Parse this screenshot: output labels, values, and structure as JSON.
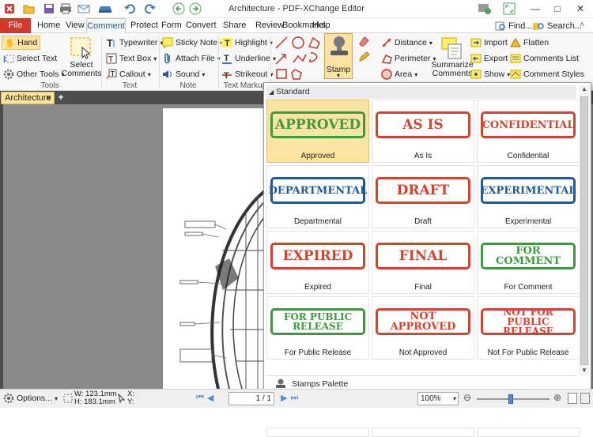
{
  "window": {
    "title": "Architecture - PDF-XChange Editor"
  },
  "quick_access": {
    "find_label": "Find...",
    "search_label": "Search..."
  },
  "menu": [
    "File",
    "Home",
    "View",
    "Comment",
    "Protect",
    "Form",
    "Convert",
    "Share",
    "Review",
    "Bookmarks",
    "Help"
  ],
  "ribbon": {
    "tools": {
      "hand": "Hand",
      "select_text": "Select Text",
      "other_tools": "Other Tools",
      "select_comments": "Select Comments",
      "group": "Tools"
    },
    "text": {
      "typewriter": "Typewriter",
      "text_box": "Text Box",
      "callout": "Callout",
      "group": "Text"
    },
    "note": {
      "sticky_note": "Sticky Note",
      "attach_file": "Attach File",
      "sound": "Sound",
      "group": "Note"
    },
    "markup": {
      "highlight": "Highlight",
      "underline": "Underline",
      "strikeout": "Strikeout",
      "group": "Text Markup"
    },
    "stamp": {
      "label": "Stamp"
    },
    "measure": {
      "distance": "Distance",
      "perimeter": "Perimeter",
      "area": "Area"
    },
    "manage": {
      "summarize": "Summarize Comments",
      "import": "Import",
      "export": "Export",
      "show": "Show",
      "flatten": "Flatten",
      "comments_list": "Comments List",
      "comment_styles": "Comment Styles"
    }
  },
  "doc_tab": {
    "name": "Architecture"
  },
  "stamps_panel": {
    "section": "Standard",
    "stamps": [
      {
        "text": "APPROVED",
        "caption": "Approved",
        "color": "#3e9a3e"
      },
      {
        "text": "AS IS",
        "caption": "As Is",
        "color": "#d4442d"
      },
      {
        "text": "CONFIDENTIAL",
        "caption": "Confidential",
        "color": "#d4442d"
      },
      {
        "text": "DEPARTMENTAL",
        "caption": "Departmental",
        "color": "#1f5a96"
      },
      {
        "text": "DRAFT",
        "caption": "Draft",
        "color": "#d4442d"
      },
      {
        "text": "EXPERIMENTAL",
        "caption": "Experimental",
        "color": "#1f5a96"
      },
      {
        "text": "EXPIRED",
        "caption": "Expired",
        "color": "#d4442d"
      },
      {
        "text": "FINAL",
        "caption": "Final",
        "color": "#d4442d"
      },
      {
        "text": "FOR COMMENT",
        "caption": "For Comment",
        "color": "#3e9a3e"
      },
      {
        "text": "FOR PUBLIC RELEASE",
        "caption": "For Public Release",
        "color": "#3e9a3e"
      },
      {
        "text": "NOT APPROVED",
        "caption": "Not Approved",
        "color": "#d4442d"
      },
      {
        "text": "NOT FOR PUBLIC RELEASE",
        "caption": "Not For Public Release",
        "color": "#d4442d"
      }
    ],
    "palette_label": "Stamps Palette"
  },
  "statusbar": {
    "options": "Options...",
    "width": "W: 123.1mm",
    "height": "H: 183.1mm",
    "x": "X:",
    "y": "Y:",
    "page": "1 / 1",
    "zoom": "100%"
  }
}
